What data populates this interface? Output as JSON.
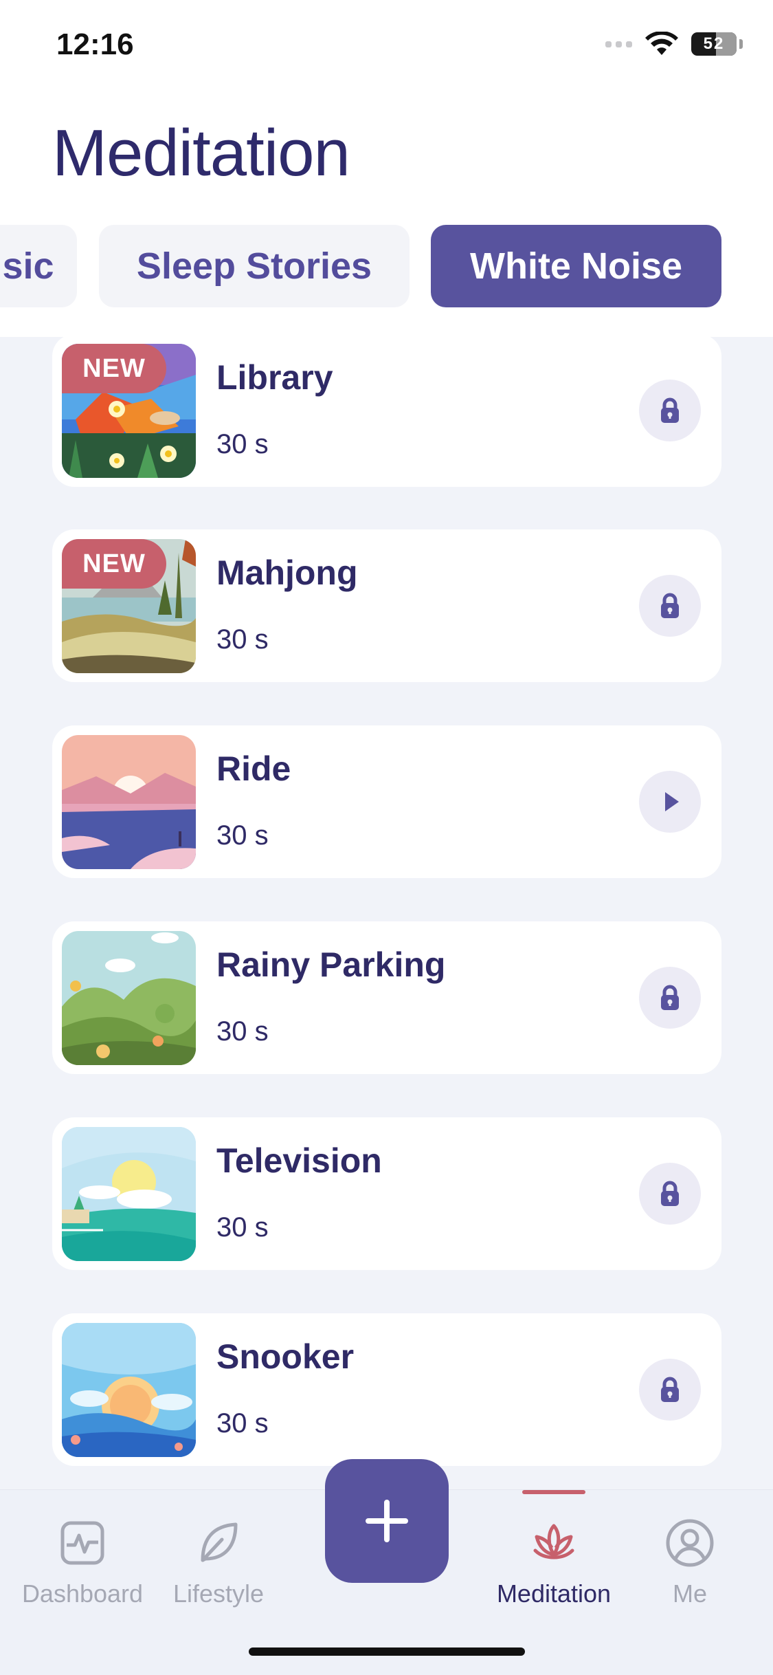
{
  "status_bar": {
    "time": "12:16",
    "battery": "52"
  },
  "page": {
    "title": "Meditation"
  },
  "categories": [
    {
      "label": "sic",
      "active": false
    },
    {
      "label": "Sleep Stories",
      "active": false
    },
    {
      "label": "White Noise",
      "active": true
    }
  ],
  "items": [
    {
      "title": "Library",
      "duration": "30 s",
      "badge": "NEW",
      "action": "lock-icon"
    },
    {
      "title": "Mahjong",
      "duration": "30 s",
      "badge": "NEW",
      "action": "lock-icon"
    },
    {
      "title": "Ride",
      "duration": "30 s",
      "badge": "",
      "action": "play-icon"
    },
    {
      "title": "Rainy Parking",
      "duration": "30 s",
      "badge": "",
      "action": "lock-icon"
    },
    {
      "title": "Television",
      "duration": "30 s",
      "badge": "",
      "action": "lock-icon"
    },
    {
      "title": "Snooker",
      "duration": "30 s",
      "badge": "",
      "action": "lock-icon"
    }
  ],
  "tabbar": {
    "tabs": [
      {
        "label": "Dashboard",
        "icon": "pulse-icon",
        "active": false
      },
      {
        "label": "Lifestyle",
        "icon": "leaf-icon",
        "active": false
      },
      {
        "label": "Meditation",
        "icon": "lotus-icon",
        "active": true
      },
      {
        "label": "Me",
        "icon": "user-icon",
        "active": false
      }
    ],
    "fab_icon": "plus-icon",
    "fab_label": "+"
  },
  "colors": {
    "accent": "#58539e",
    "badge": "#c7606c",
    "text_primary": "#2f2a66",
    "text_inactive": "#a5a8b4",
    "background": "#f1f3f9"
  }
}
